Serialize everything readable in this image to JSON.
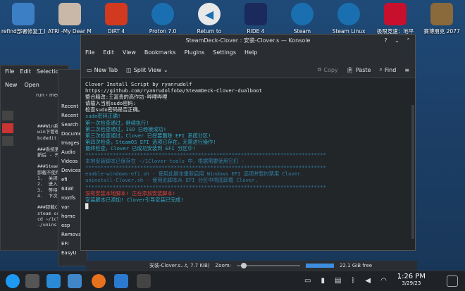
{
  "desktop_icons": [
    {
      "label": "refind部署修复工具",
      "label2": "工具",
      "icon": "folder-icon"
    },
    {
      "label": "ATRI -My Dear Moments-",
      "icon": "game-icon"
    },
    {
      "label": "DiRT 4",
      "icon": "game-icon"
    },
    {
      "label": "Proton 7.0",
      "icon": "steam-icon"
    },
    {
      "label": "Return to",
      "icon": "return-icon"
    },
    {
      "label": "RIDE 4",
      "icon": "game-icon"
    },
    {
      "label": "Steam",
      "icon": "steam-icon"
    },
    {
      "label": "Steam Linux",
      "icon": "steam-icon"
    },
    {
      "label": "极限竞速：地平",
      "icon": "game-icon"
    },
    {
      "label": "赛博朋克 2077",
      "icon": "game-icon"
    }
  ],
  "konsole": {
    "title": "SteamDeck-Clover : 安装-Clover.s — Konsole",
    "menu": [
      "File",
      "Edit",
      "View",
      "Bookmarks",
      "Plugins",
      "Settings",
      "Help"
    ],
    "toolbar": {
      "new_tab": "New Tab",
      "split_view": "Split View",
      "copy": "Copy",
      "paste": "Paste",
      "find": "Find"
    },
    "lines": [
      {
        "t": "Clover Install Script by ryanrudolf",
        "c": "w"
      },
      {
        "t": "https://github.com/ryanrudolfoba/SteamDeck-Clover-dualboot",
        "c": "w"
      },
      {
        "t": "整合精改:王富贵的高作坊-哔哩哔哩",
        "c": "w"
      },
      {
        "t": "请输入当前sudo密码:",
        "c": "w"
      },
      {
        "t": "检查sudo密码是否正确。",
        "c": "w"
      },
      {
        "t": "sudo密码正确!",
        "c": "c"
      },
      {
        "t": "第一次检查通过，继续执行!",
        "c": "c"
      },
      {
        "t": "第二次检查通过，ISO 已经被成功!",
        "c": "c"
      },
      {
        "t": "第三次检查通过，Clover 已经要删除 EFI 系统分区!",
        "c": "c"
      },
      {
        "t": "第四次检查，SteamOS EFI 选项已存在，无需进行操作!",
        "c": "c"
      },
      {
        "t": "最终检查，Clover 已成功安装到 EFI 分区中!",
        "c": "c"
      },
      {
        "t": "*******************************************************************************",
        "c": "b"
      },
      {
        "t": "本地安装脚本已保存在 ~/1Clover-tools 中，根据需要使用它们 -",
        "c": "b"
      },
      {
        "t": "*******************************************************************************",
        "c": "b"
      },
      {
        "t": "enable-windows-efi.sh - 使用此脚本重新启用 Windows EFI 选项并暂时禁用 Clover.",
        "c": "b"
      },
      {
        "t": "uninstall-Clover.sh - 使用此脚本从 EFI 分区中彻底卸载 Clover.",
        "c": "b"
      },
      {
        "t": "*******************************************************************************",
        "c": "b"
      },
      {
        "t": "",
        "c": "w"
      },
      {
        "t": "没有安装本地脚本! 正在添加安装脚本!",
        "c": "r"
      },
      {
        "t": "安装脚本已添加! Clover引导安装已完成!",
        "c": "c"
      },
      {
        "t": "█",
        "c": "w"
      }
    ]
  },
  "bg_window": {
    "menu": [
      "File",
      "Edit",
      "Selection"
    ],
    "new": "New",
    "open": "Open",
    "paths": [
      "run",
      "media",
      "de"
    ],
    "lines": [
      "###Win系统",
      "win下管理",
      "bcdedit.",
      "",
      "###系统更",
      "新后 - 开",
      "",
      "###Steam",
      "卸载不使用",
      "1.  关闭",
      "2.  进入",
      "3.  等待",
      "4.  下次",
      "",
      "###卸载Cl",
      "steam os",
      "cd ~/1cl",
      "./unins"
    ]
  },
  "file_panel": {
    "places": [
      "Recent",
      "Recent",
      "Search For",
      "Documents",
      "Images",
      "Audio",
      "Videos"
    ],
    "devices_header": "Devices",
    "devices": [
      "efi",
      "64Wi",
      "rootfs",
      "var",
      "home",
      "esp"
    ],
    "removable_header": "Removable Devices",
    "removable": [
      "EFI",
      "EasyU"
    ],
    "filename": "安装-Clover.s...t, 7.7 KiB)",
    "zoom_label": "Zoom:",
    "free": "22.1 GiB free",
    "preview": "说明"
  },
  "taskbar": {
    "time": "1:26 PM",
    "date": "3/29/23"
  }
}
